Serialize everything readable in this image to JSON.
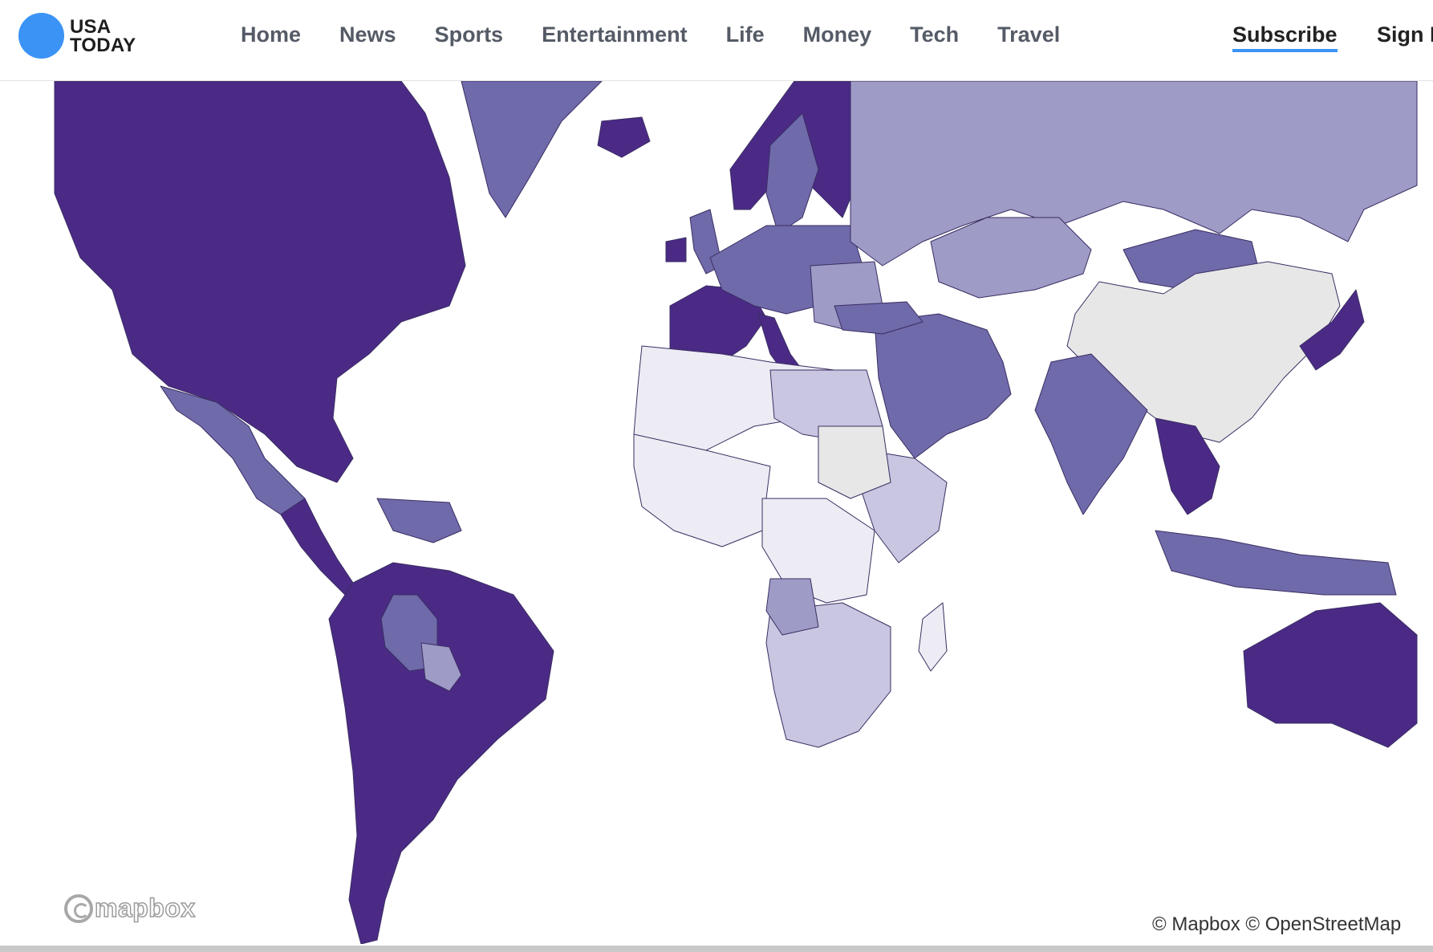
{
  "header": {
    "logo": {
      "line1": "USA",
      "line2": "TODAY",
      "dot_color": "#3b93f5",
      "icon": "usa-today-dot-icon"
    },
    "nav": [
      {
        "label": "Home"
      },
      {
        "label": "News"
      },
      {
        "label": "Sports"
      },
      {
        "label": "Entertainment"
      },
      {
        "label": "Life"
      },
      {
        "label": "Money"
      },
      {
        "label": "Tech"
      },
      {
        "label": "Travel"
      }
    ],
    "subscribe_label": "Subscribe",
    "signin_label": "Sign In"
  },
  "map": {
    "type": "choropleth",
    "palette": {
      "darkest": "#4b2a86",
      "dark": "#6f6aaa",
      "medium": "#9e9bc6",
      "light": "#c8c6e0",
      "lightest": "#edecf4",
      "no_data": "#e7e7e7"
    },
    "regions": [
      {
        "shape": "north-america",
        "level": "darkest"
      },
      {
        "shape": "mexico",
        "level": "dark"
      },
      {
        "shape": "central-america",
        "level": "darkest"
      },
      {
        "shape": "south-america",
        "level": "darkest"
      },
      {
        "shape": "bolivia",
        "level": "dark"
      },
      {
        "shape": "paraguay",
        "level": "medium"
      },
      {
        "shape": "venezuela",
        "level": "dark"
      },
      {
        "shape": "greenland",
        "level": "dark"
      },
      {
        "shape": "iceland",
        "level": "darkest"
      },
      {
        "shape": "norway-finland",
        "level": "darkest"
      },
      {
        "shape": "sweden",
        "level": "dark"
      },
      {
        "shape": "uk",
        "level": "dark"
      },
      {
        "shape": "ireland",
        "level": "darkest"
      },
      {
        "shape": "iberia-france",
        "level": "darkest"
      },
      {
        "shape": "italy",
        "level": "darkest"
      },
      {
        "shape": "central-europe",
        "level": "dark"
      },
      {
        "shape": "eastern-europe",
        "level": "medium"
      },
      {
        "shape": "russia",
        "level": "medium"
      },
      {
        "shape": "kazakhstan",
        "level": "medium"
      },
      {
        "shape": "mongolia",
        "level": "dark"
      },
      {
        "shape": "china",
        "level": "no_data"
      },
      {
        "shape": "middle-east",
        "level": "dark"
      },
      {
        "shape": "turkey",
        "level": "dark"
      },
      {
        "shape": "india",
        "level": "dark"
      },
      {
        "shape": "southeast-asia",
        "level": "darkest"
      },
      {
        "shape": "japan-korea",
        "level": "darkest"
      },
      {
        "shape": "indonesia",
        "level": "dark"
      },
      {
        "shape": "australia",
        "level": "darkest"
      },
      {
        "shape": "north-africa",
        "level": "lightest"
      },
      {
        "shape": "egypt-libya",
        "level": "light"
      },
      {
        "shape": "west-africa",
        "level": "lightest"
      },
      {
        "shape": "central-africa",
        "level": "lightest"
      },
      {
        "shape": "east-africa",
        "level": "light"
      },
      {
        "shape": "sudan",
        "level": "no_data"
      },
      {
        "shape": "southern-africa",
        "level": "light"
      },
      {
        "shape": "angola",
        "level": "medium"
      },
      {
        "shape": "madagascar",
        "level": "lightest"
      }
    ]
  },
  "footer": {
    "mapbox_logo": "mapbox",
    "attribution": "© Mapbox © OpenStreetMap"
  }
}
